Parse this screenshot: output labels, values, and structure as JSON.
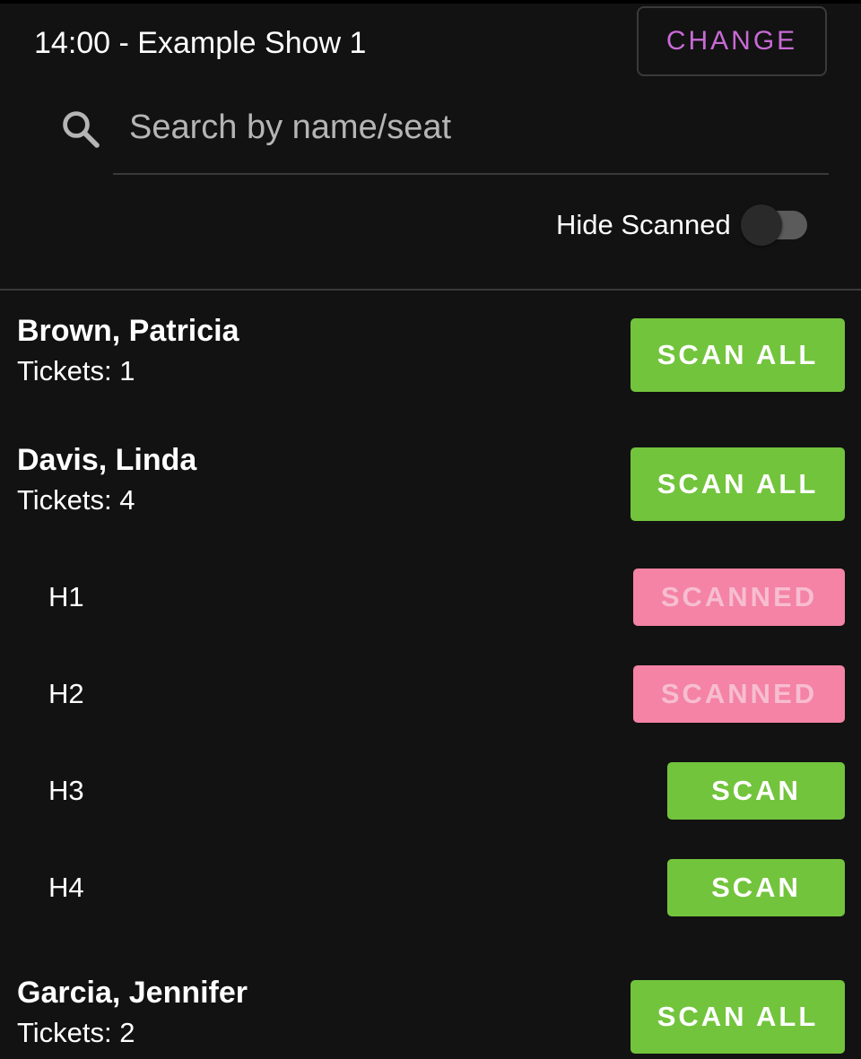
{
  "header": {
    "show_title": "14:00 - Example Show 1",
    "change_label": "CHANGE"
  },
  "search": {
    "placeholder": "Search by name/seat",
    "value": ""
  },
  "filter": {
    "hide_scanned_label": "Hide Scanned",
    "hide_scanned_on": false
  },
  "colors": {
    "background": "#121212",
    "scan_green": "#72c43c",
    "scanned_pink": "#f483a5",
    "change_purple": "#c86ad6"
  },
  "guests": [
    {
      "name": "Brown, Patricia",
      "tickets_label": "Tickets: 1",
      "action_label": "SCAN ALL",
      "seats": []
    },
    {
      "name": "Davis, Linda",
      "tickets_label": "Tickets: 4",
      "action_label": "SCAN ALL",
      "seats": [
        {
          "seat": "H1",
          "status_label": "SCANNED"
        },
        {
          "seat": "H2",
          "status_label": "SCANNED"
        },
        {
          "seat": "H3",
          "status_label": "SCAN"
        },
        {
          "seat": "H4",
          "status_label": "SCAN"
        }
      ]
    },
    {
      "name": "Garcia, Jennifer",
      "tickets_label": "Tickets: 2",
      "action_label": "SCAN ALL",
      "seats": []
    }
  ]
}
